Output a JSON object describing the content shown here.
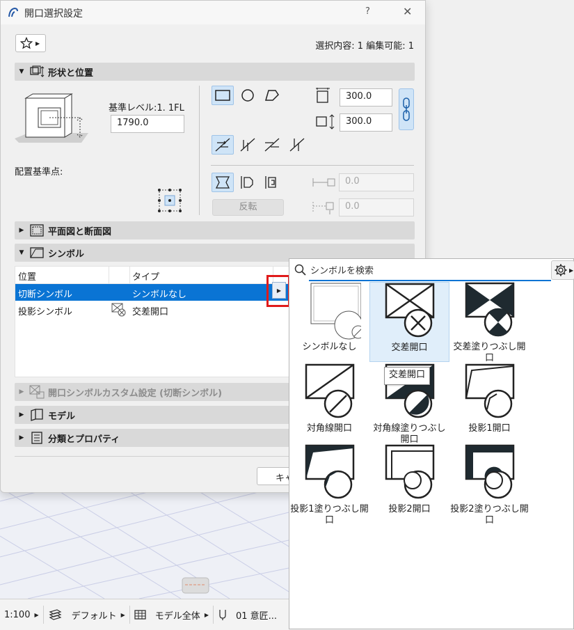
{
  "dialog": {
    "title": "開口選択設定",
    "help": "?",
    "close": "✕",
    "selection_info": "選択内容: 1 編集可能: 1"
  },
  "sections": {
    "shape_position": "形状と位置",
    "plan_section": "平面図と断面図",
    "symbol": "シンボル",
    "custom_symbol": "開口シンボルカスタム設定 (切断シンボル)",
    "model": "モデル",
    "classification": "分類とプロパティ"
  },
  "shape": {
    "base_level_label": "基準レベル:1. 1FL",
    "base_level_value": "1790.0",
    "anchor_label": "配置基準点:",
    "width_value": "300.0",
    "height_value": "300.0",
    "offset1_value": "0.0",
    "offset2_value": "0.0",
    "flip_label": "反転"
  },
  "symbol_table": {
    "headers": [
      "位置",
      "タイプ"
    ],
    "rows": [
      {
        "position": "切断シンボル",
        "type": "シンボルなし",
        "selected": true
      },
      {
        "position": "投影シンボル",
        "type": "交差開口",
        "selected": false
      }
    ]
  },
  "cancel_label": "キャ",
  "picker": {
    "search_placeholder": "シンボルを検索",
    "tiles": [
      "シンボルなし",
      "交差開口",
      "交差塗りつぶし開口",
      "対角線開口",
      "対角線塗りつぶし開口",
      "投影1開口",
      "投影1塗りつぶし開口",
      "投影2開口",
      "投影2塗りつぶし開口"
    ],
    "tooltip": "交差開口"
  },
  "statusbar": {
    "scale": "1:100",
    "layer": "デフォルト",
    "model_view": "モデル全体",
    "story": "01 意匠..."
  },
  "colors": {
    "accent": "#0a74d4",
    "highlight": "#e01b1b",
    "selected_bg": "#cfe4f7"
  }
}
